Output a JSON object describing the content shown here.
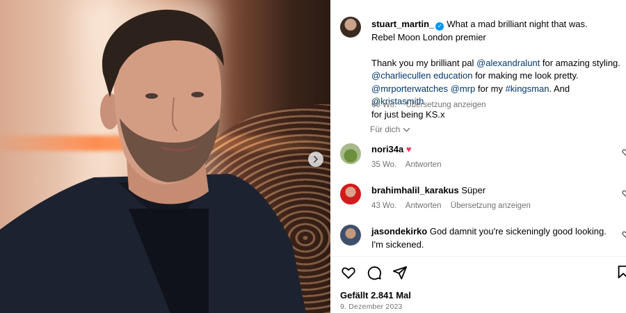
{
  "post": {
    "author": "stuart_martin_",
    "caption_line1": "What a mad brilliant night that was.",
    "caption_line2": "Rebel Moon London premier",
    "caption_p2_a": "Thank you my brilliant pal ",
    "mention_1": "@alexandralunt",
    "caption_p2_b": " for amazing styling.",
    "mention_2": "@charliecullen education",
    "caption_p2_c": " for making me look pretty.",
    "mention_3": "@mrporterwatches",
    "mention_4": "@mrp",
    "caption_p2_d": " for my ",
    "hashtag_1": "#kingsman",
    "caption_p2_e": ". And ",
    "mention_5": "@kristasmith",
    "caption_p2_f": "for just being KS.x",
    "time": "60 Wo.",
    "translate": "Übersetzung anzeigen",
    "more_label": "Für dich",
    "likes": "Gefällt 2.841 Mal",
    "date": "9. Dezember 2023"
  },
  "comments": [
    {
      "user": "nori34a",
      "text": "",
      "emoji": "heart",
      "time": "35 Wo.",
      "reply": "Antworten",
      "translate": ""
    },
    {
      "user": "brahimhalil_karakus",
      "text": "Süper",
      "time": "43 Wo.",
      "reply": "Antworten",
      "translate": "Übersetzung anzeigen"
    },
    {
      "user": "jasondekirko",
      "text": "God damnit you're sickeningly good looking. I'm sickened."
    }
  ],
  "icons": {
    "like": "heart-icon",
    "comment": "comment-icon",
    "share": "share-icon",
    "save": "bookmark-icon",
    "verified": "verified-badge-icon",
    "next": "chevron-right-icon"
  },
  "colors": {
    "link": "#00376b",
    "verified": "#0095f6",
    "muted": "#737373",
    "heart": "#f2335d"
  }
}
